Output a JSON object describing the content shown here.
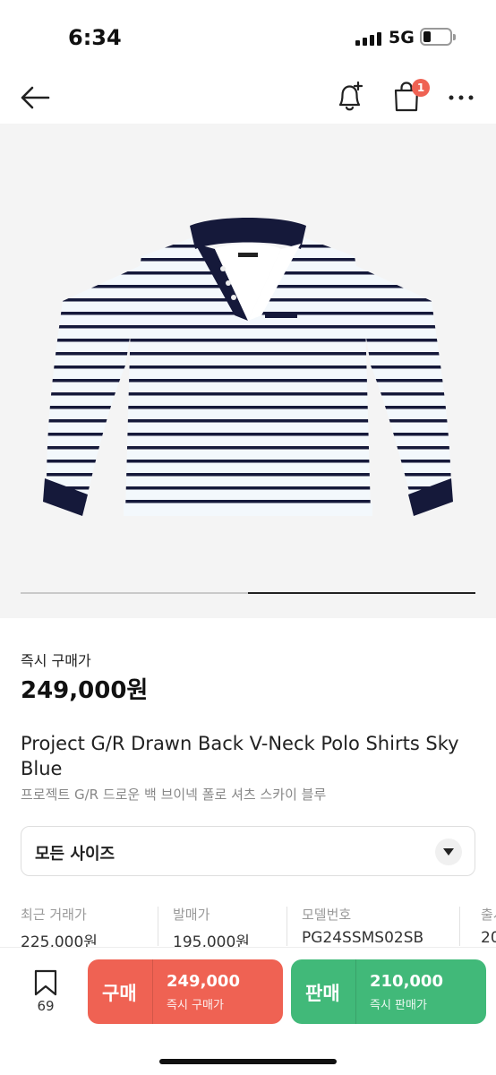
{
  "status_bar": {
    "time": "6:34",
    "network": "5G"
  },
  "nav": {
    "cart_badge": "1"
  },
  "product": {
    "price_label": "즉시 구매가",
    "price": "249,000원",
    "title": "Project G/R Drawn Back V-Neck Polo Shirts Sky Blue",
    "subtitle": "프로젝트 G/R 드로운 백 브이넥 폴로 셔츠 스카이 블루",
    "image_progress": 0.5
  },
  "size_select": {
    "label": "모든 사이즈"
  },
  "info": [
    {
      "label": "최근 거래가",
      "value": "225,000원"
    },
    {
      "label": "발매가",
      "value": "195,000원"
    },
    {
      "label": "모델번호",
      "value": "PG24SSMS02SB"
    },
    {
      "label": "출시",
      "value": "20"
    }
  ],
  "bottom": {
    "wishlist_count": "69",
    "buy": {
      "label": "구매",
      "price": "249,000",
      "sub": "즉시 구매가",
      "color": "#ef6253"
    },
    "sell": {
      "label": "판매",
      "price": "210,000",
      "sub": "즉시 판매가",
      "color": "#41b979"
    }
  }
}
